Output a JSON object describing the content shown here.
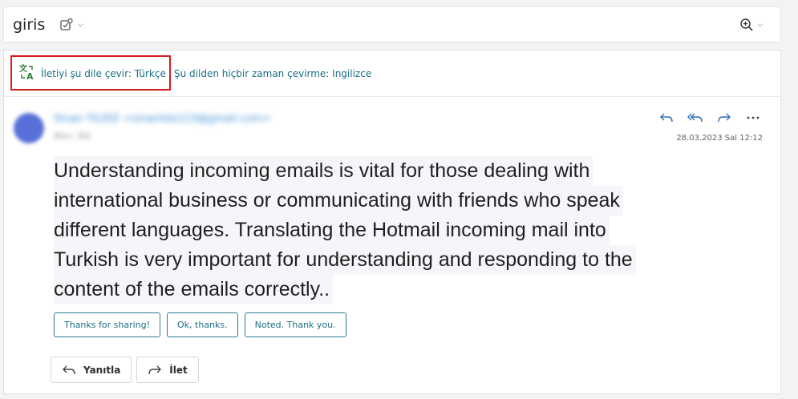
{
  "header": {
    "subject": "giris",
    "tag_icon": "tag-icon",
    "zoom_icon": "zoom-in-icon"
  },
  "translate_bar": {
    "translate_link": "İletiyi şu dile çevir: Türkçe",
    "never_translate_link": "Şu dilden hiçbir zaman çevirme: Ingilizce",
    "translate_icon": "translate-icon",
    "highlight_color": "#d71c1c"
  },
  "message": {
    "sender": "Sinan YILDIZ <sinanildz123@gmail.com>",
    "recipient": "Alıcı: Siz",
    "date": "28.03.2023 Sal 12:12",
    "body_lines": [
      "Understanding incoming emails is vital for those dealing with",
      "international business or communicating with friends who speak",
      "different languages. Translating the Hotmail incoming mail into",
      "Turkish is very important for understanding and responding to the",
      "content of the emails correctly.."
    ]
  },
  "actions": {
    "reply_icon": "reply-icon",
    "reply_all_icon": "reply-all-icon",
    "forward_icon": "forward-icon",
    "more_icon": "more-icon"
  },
  "suggested_replies": [
    "Thanks for sharing!",
    "Ok, thanks.",
    "Noted. Thank you."
  ],
  "reply_bar": {
    "reply_label": "Yanıtla",
    "forward_label": "İlet"
  },
  "colors": {
    "accent": "#1a6f87",
    "action_blue": "#2f6fb6"
  }
}
